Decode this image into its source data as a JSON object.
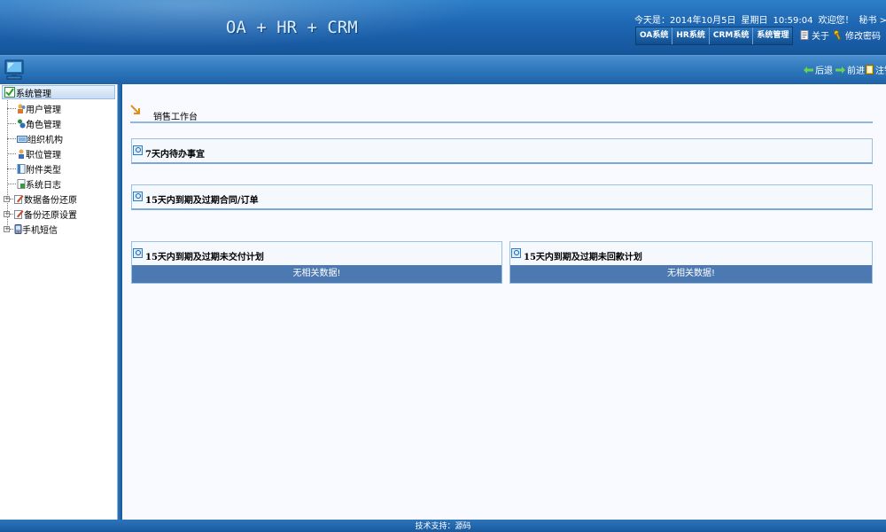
{
  "header": {
    "app_title": "OA + HR + CRM",
    "date_text": "今天是：2014年10月5日",
    "weekday": "星期日",
    "time": "10:59:04",
    "welcome": "欢迎您！",
    "user_role": "秘书 > 管理员",
    "tabs": [
      {
        "label": "OA系统"
      },
      {
        "label": "HR系统"
      },
      {
        "label": "CRM系统"
      },
      {
        "label": "系统管理"
      }
    ],
    "about_label": "关于",
    "change_password_label": "修改密码"
  },
  "toolbar": {
    "back_label": "后退",
    "forward_label": "前进",
    "logout_label": "注销"
  },
  "sidebar": {
    "root_label": "系统管理",
    "items": [
      {
        "label": "用户管理",
        "icon": "users-icon"
      },
      {
        "label": "角色管理",
        "icon": "roles-icon"
      },
      {
        "label": "组织机构",
        "icon": "org-icon"
      },
      {
        "label": "职位管理",
        "icon": "position-icon"
      },
      {
        "label": "附件类型",
        "icon": "attachment-icon"
      },
      {
        "label": "系统日志",
        "icon": "log-icon"
      },
      {
        "label": "数据备份还原",
        "icon": "backup-icon",
        "expandable": true
      },
      {
        "label": "备份还原设置",
        "icon": "backup-settings-icon",
        "expandable": true
      },
      {
        "label": "手机短信",
        "icon": "sms-icon",
        "expandable": true
      }
    ]
  },
  "main": {
    "workbench_title": "销售工作台",
    "panels": [
      {
        "title": "7天内待办事宜"
      },
      {
        "title": "15天内到期及过期合同/订单"
      },
      {
        "title": "15天内到期及过期未交付计划",
        "empty_text": "无相关数据!"
      },
      {
        "title": "15天内到期及过期未回款计划",
        "empty_text": "无相关数据!"
      }
    ]
  },
  "footer": {
    "text": "技术支持：源码"
  },
  "colors": {
    "header_blue": "#1f68b4",
    "empty_bar": "#4c79b2",
    "panel_border": "#9ec0e0"
  }
}
